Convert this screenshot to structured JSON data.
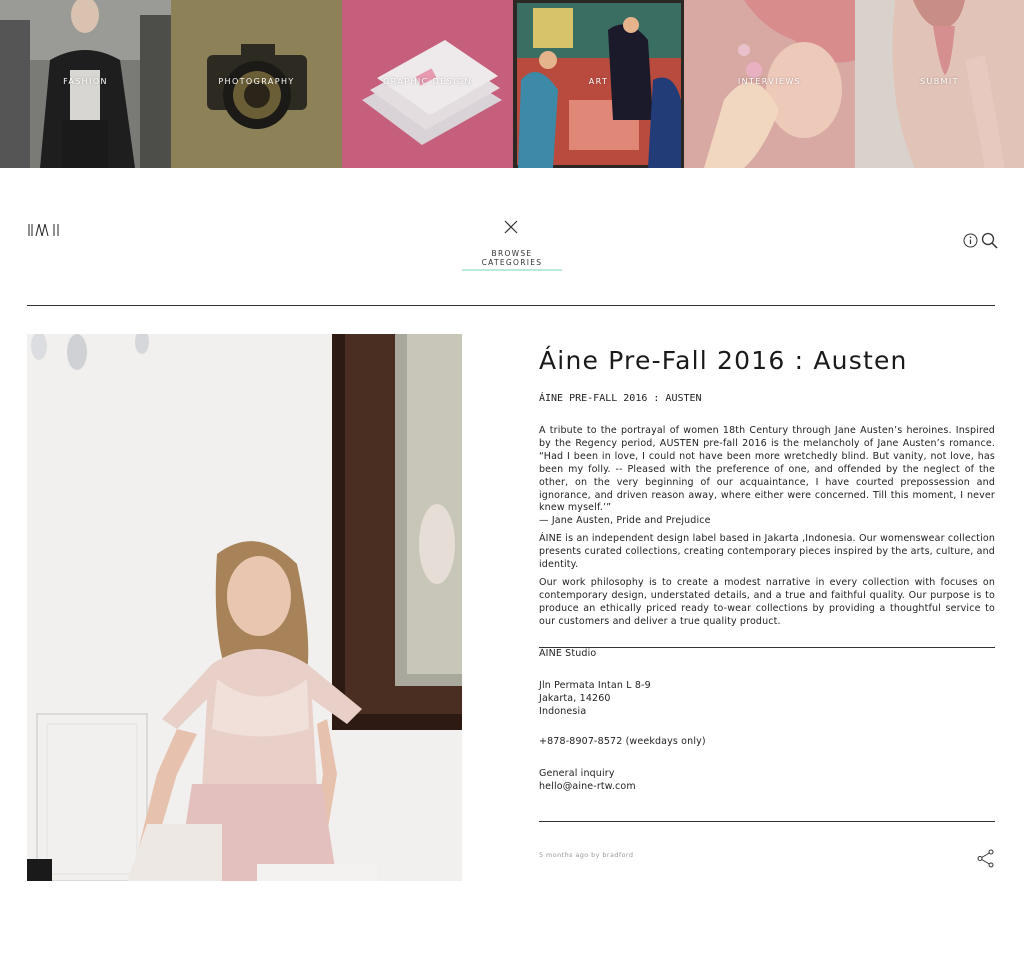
{
  "categories": [
    {
      "label": "FASHION",
      "bg": "#6b6a66"
    },
    {
      "label": "PHOTOGRAPHY",
      "bg": "#8a7d54"
    },
    {
      "label": "GRAPHIC DESIGN",
      "bg": "#c9627e"
    },
    {
      "label": "ART",
      "bg": "#a83a3a"
    },
    {
      "label": "INTERVIEWS",
      "bg": "#d9a7a2"
    },
    {
      "label": "SUBMIT",
      "bg": "#c9bdb5"
    }
  ],
  "header": {
    "browse_label": "BROWSE CATEGORIES",
    "accent": "#b8ecd9"
  },
  "article": {
    "title": "Áine Pre-Fall 2016 : Austen",
    "subtitle": "ÁINE PRE-FALL 2016 : AUSTEN",
    "para1": "A tribute to the portrayal of women 18th Century through Jane Austen’s heroines. Inspired by the Regency period, AUSTEN pre-fall 2016 is the melancholy of Jane Austen’s romance. “Had I been in love, I could not have been more wretchedly blind. But vanity, not love, has been my folly. -- Pleased with the preference of one, and offended by the neglect of the other, on the very beginning of our acquaintance, I have courted prepossession and ignorance, and driven reason away, where either were concerned. Till this moment, I never knew myself.’”",
    "para1_attr": "— Jane Austen, Pride and Prejudice",
    "para2": "ÁINE is an independent design label based in Jakarta ,Indonesia. Our womenswear collection presents curated collections, creating contemporary pieces inspired by the arts, culture, and identity.",
    "para3": "Our work philosophy is to create a modest narrative in every collection with focuses on contemporary design, understated details, and a true and faithful quality. Our purpose is to produce an ethically priced ready to-wear collections by providing a thoughtful service to our customers and deliver a true quality product.",
    "studio": "ÁINE Studio",
    "address_line1": "Jln Permata Intan L 8-9",
    "address_line2": "Jakarta, 14260",
    "address_line3": "Indonesia",
    "phone": "+878-8907-8572 (weekdays only)",
    "inquiry_label": "General inquiry",
    "email": "hello@aine-rtw.com",
    "meta": "5 months ago by bradford"
  },
  "icons": {
    "logo": "logo-icon",
    "close": "close-icon",
    "info": "info-icon",
    "search": "search-icon",
    "share": "share-icon"
  }
}
